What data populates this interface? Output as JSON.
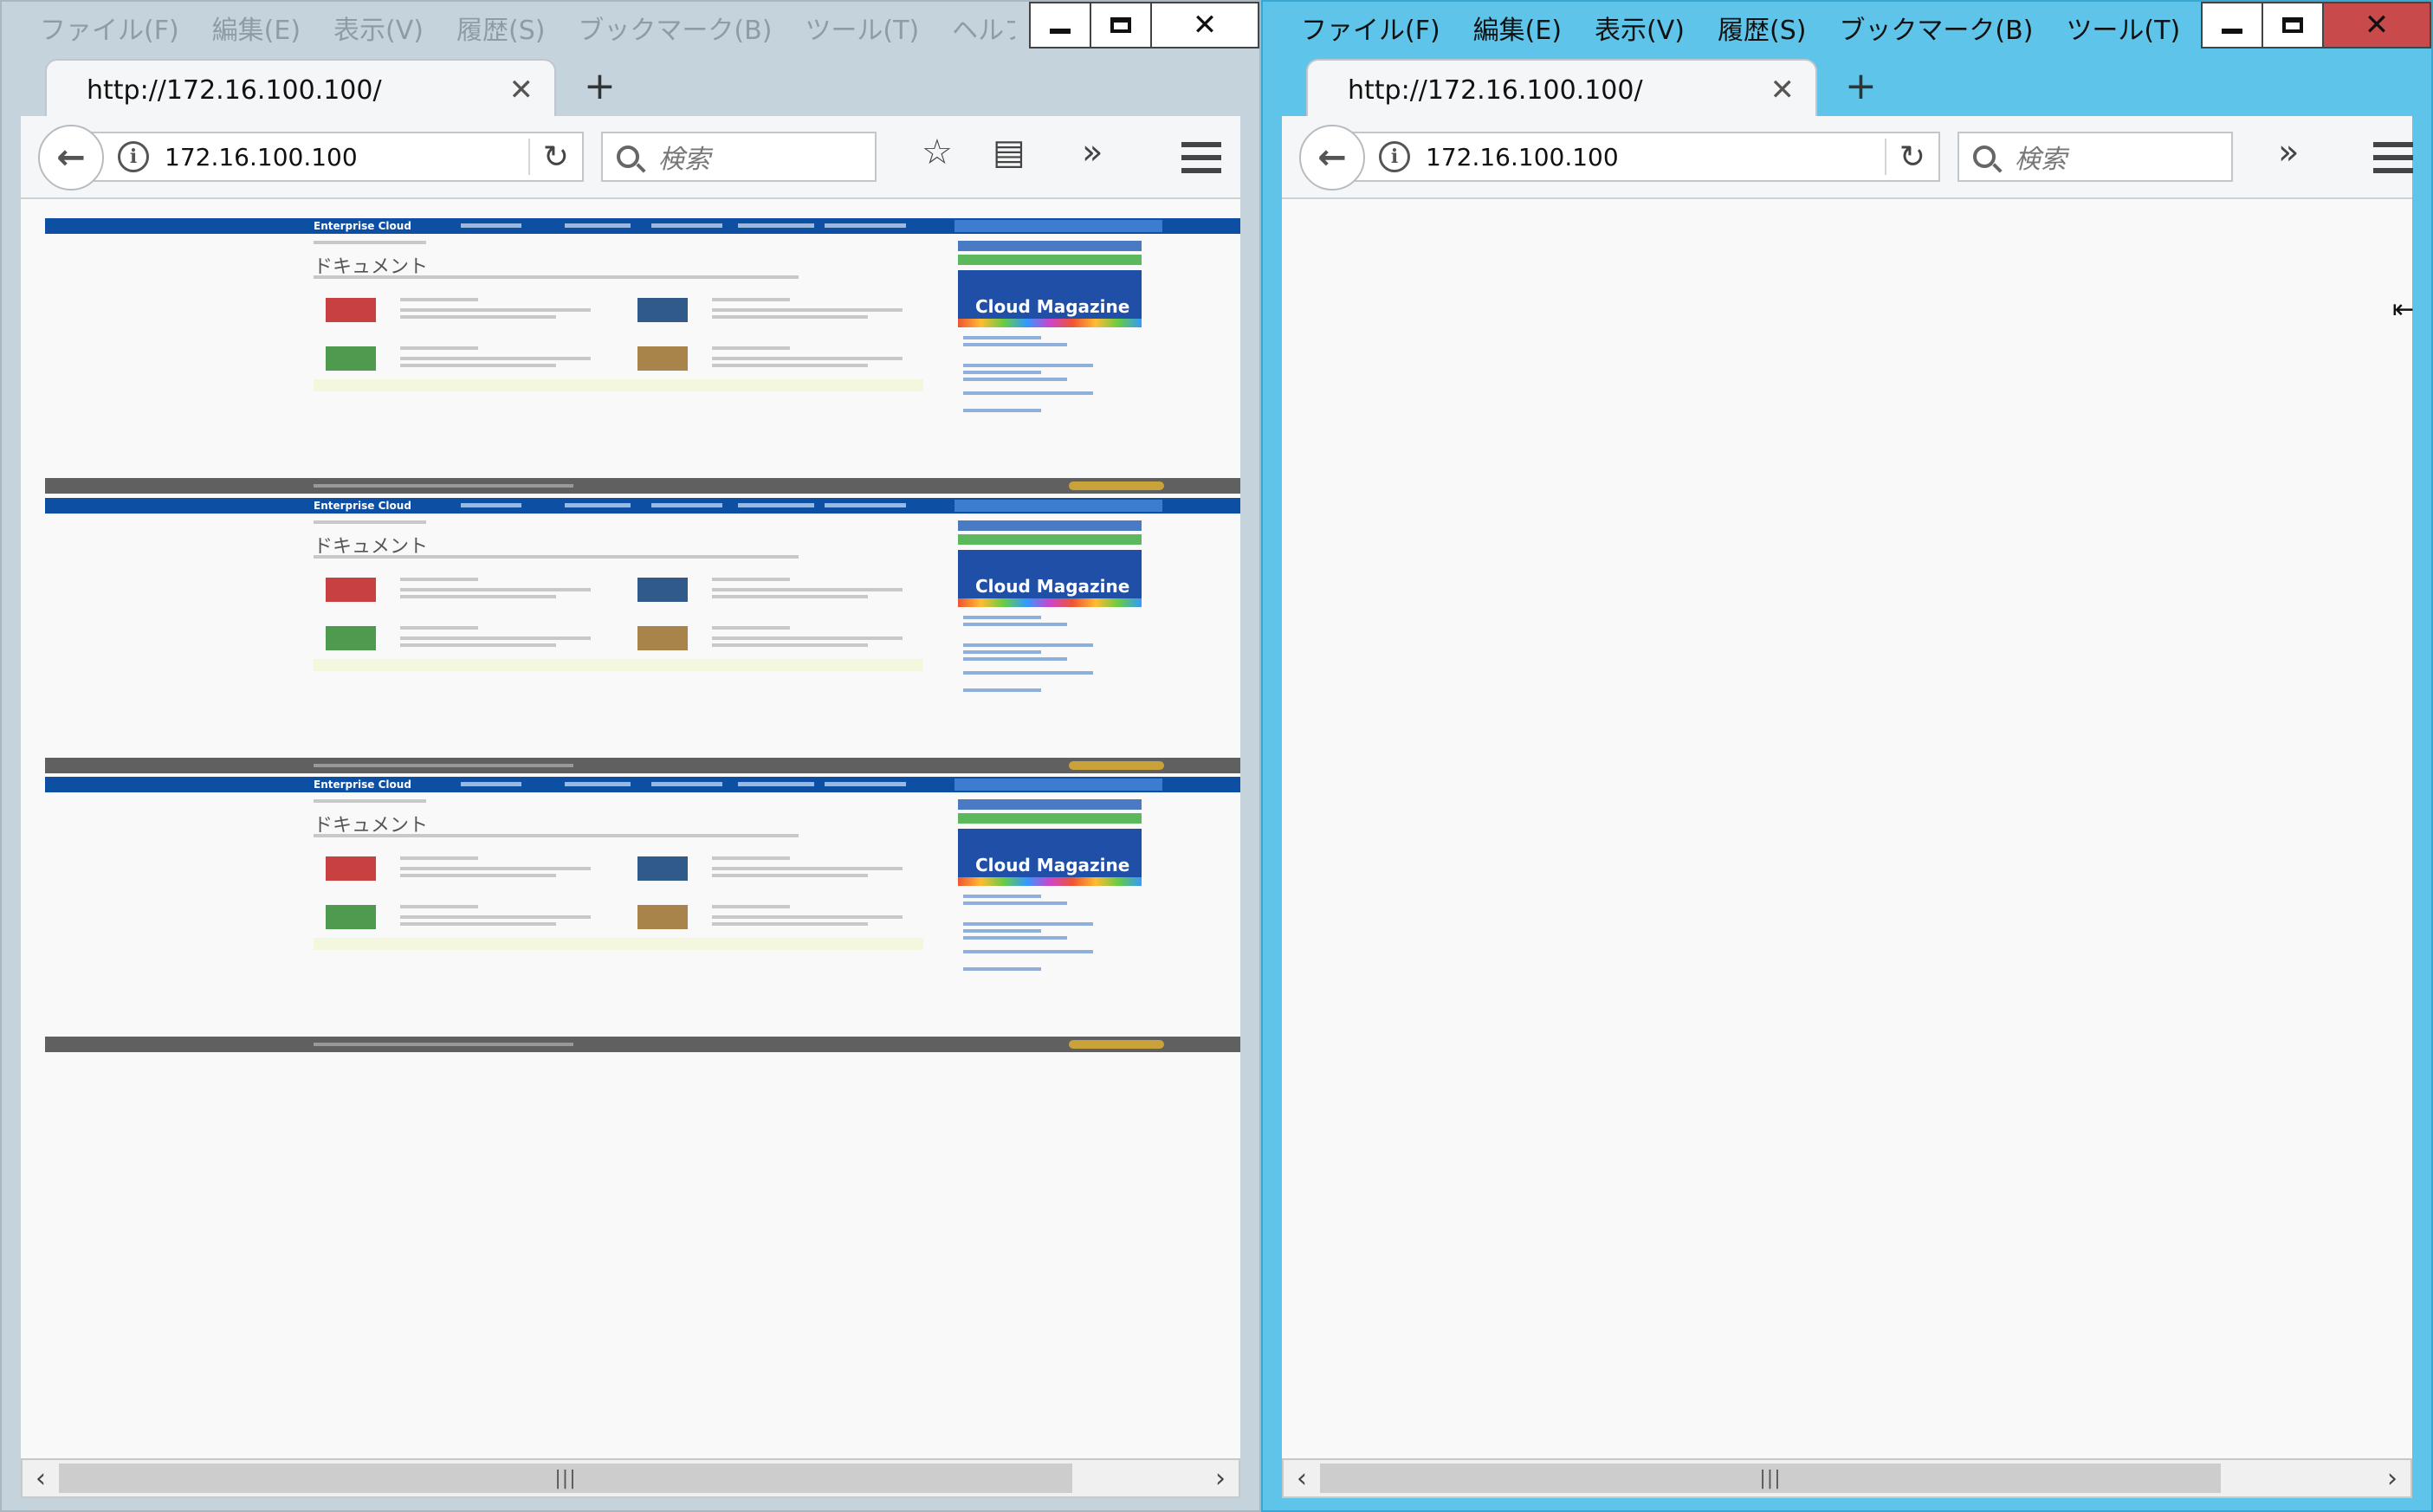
{
  "menu": [
    "ファイル(F)",
    "編集(E)",
    "表示(V)",
    "履歴(S)",
    "ブックマーク(B)",
    "ツール(T)",
    "ヘルプ(H)"
  ],
  "left_window": {
    "tab_title": "http://172.16.100.100/",
    "url": "172.16.100.100",
    "search_placeholder": "検索",
    "preview": {
      "brand": "Enterprise Cloud",
      "title": "ドキュメント",
      "ad_text": "Cloud Magazine",
      "copies": 3
    }
  },
  "right_window": {
    "tab_title": "http://172.16.100.100/",
    "url": "172.16.100.100",
    "search_placeholder": "検索"
  },
  "icons": {
    "back": "back-arrow-icon",
    "info": "info-icon",
    "reload": "reload-icon",
    "search": "search-icon",
    "bookmark": "star-icon",
    "library": "library-icon",
    "overflow": "chevron-double-right-icon",
    "menu": "hamburger-menu-icon",
    "new_tab": "plus-icon",
    "tab_close": "close-icon"
  },
  "colors": {
    "left_frame": "#c5d3dc",
    "right_frame": "#5ec4ea",
    "close_active": "#c94a4a"
  }
}
